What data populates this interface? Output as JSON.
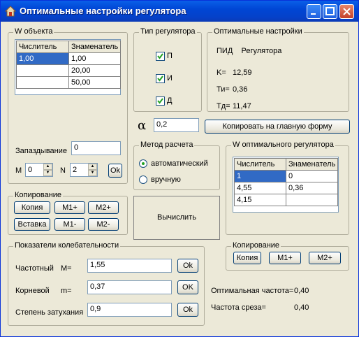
{
  "window": {
    "title": "Оптимальные настройки регулятора"
  },
  "object_w": {
    "group_label": "W объекта",
    "col_num": "Числитель",
    "col_den": "Знаменатель",
    "rows": [
      {
        "num": "1,00",
        "den": "1,00"
      },
      {
        "num": "",
        "den": "20,00"
      },
      {
        "num": "",
        "den": "50,00"
      }
    ],
    "delay_label": "Запаздывание",
    "delay_value": "0",
    "m_label": "M",
    "m_value": "0",
    "n_label": "N",
    "n_value": "2",
    "ok_label": "Ok"
  },
  "copy_left": {
    "group_label": "Копирование",
    "copy_btn": "Копия",
    "paste_btn": "Вставка",
    "m1plus": "M1+",
    "m2plus": "M2+",
    "m1minus": "M1-",
    "m2minus": "M2-"
  },
  "controller_type": {
    "group_label": "Тип регулятора",
    "p": "П",
    "i": "И",
    "d": "Д"
  },
  "optimal": {
    "group_label": "Оптимальные настройки",
    "type_text": "ПИД    Регулятора",
    "k_label": "K=",
    "k_value": "12,59",
    "ti_label": "Ти=",
    "ti_value": "0,36",
    "td_label": "Тд=",
    "td_value": "11,47"
  },
  "alpha": {
    "symbol": "α",
    "value": "0,2",
    "copy_to_main": "Копировать на главную форму"
  },
  "method": {
    "group_label": "Метод расчета",
    "auto": "автоматический",
    "manual": "вручную"
  },
  "compute_btn": "Вычислить",
  "regulator_w": {
    "group_label": "W оптимального регулятора",
    "col_num": "Числитель",
    "col_den": "Знаменатель",
    "rows": [
      {
        "num": "1",
        "den": "0"
      },
      {
        "num": "4,55",
        "den": "0,36"
      },
      {
        "num": "4,15",
        "den": ""
      }
    ]
  },
  "oscillation": {
    "group_label": "Показатели колебательности",
    "freq_label": "Частотный",
    "freq_sym": "M=",
    "freq_value": "1,55",
    "root_label": "Корневой",
    "root_sym": "m=",
    "root_value": "0,37",
    "decay_label": "Степень затухания",
    "decay_value": "0,9",
    "ok": "Ok",
    "ok2": "OK",
    "ok3": "Ok"
  },
  "copy_right": {
    "group_label": "Копирование",
    "copy_btn": "Копия",
    "m1plus": "M1+",
    "m2plus": "M2+"
  },
  "results": {
    "opt_freq_label": "Оптимальная частота=",
    "opt_freq_value": "0,40",
    "cut_freq_label": "Частота среза=",
    "cut_freq_value": "0,40"
  }
}
